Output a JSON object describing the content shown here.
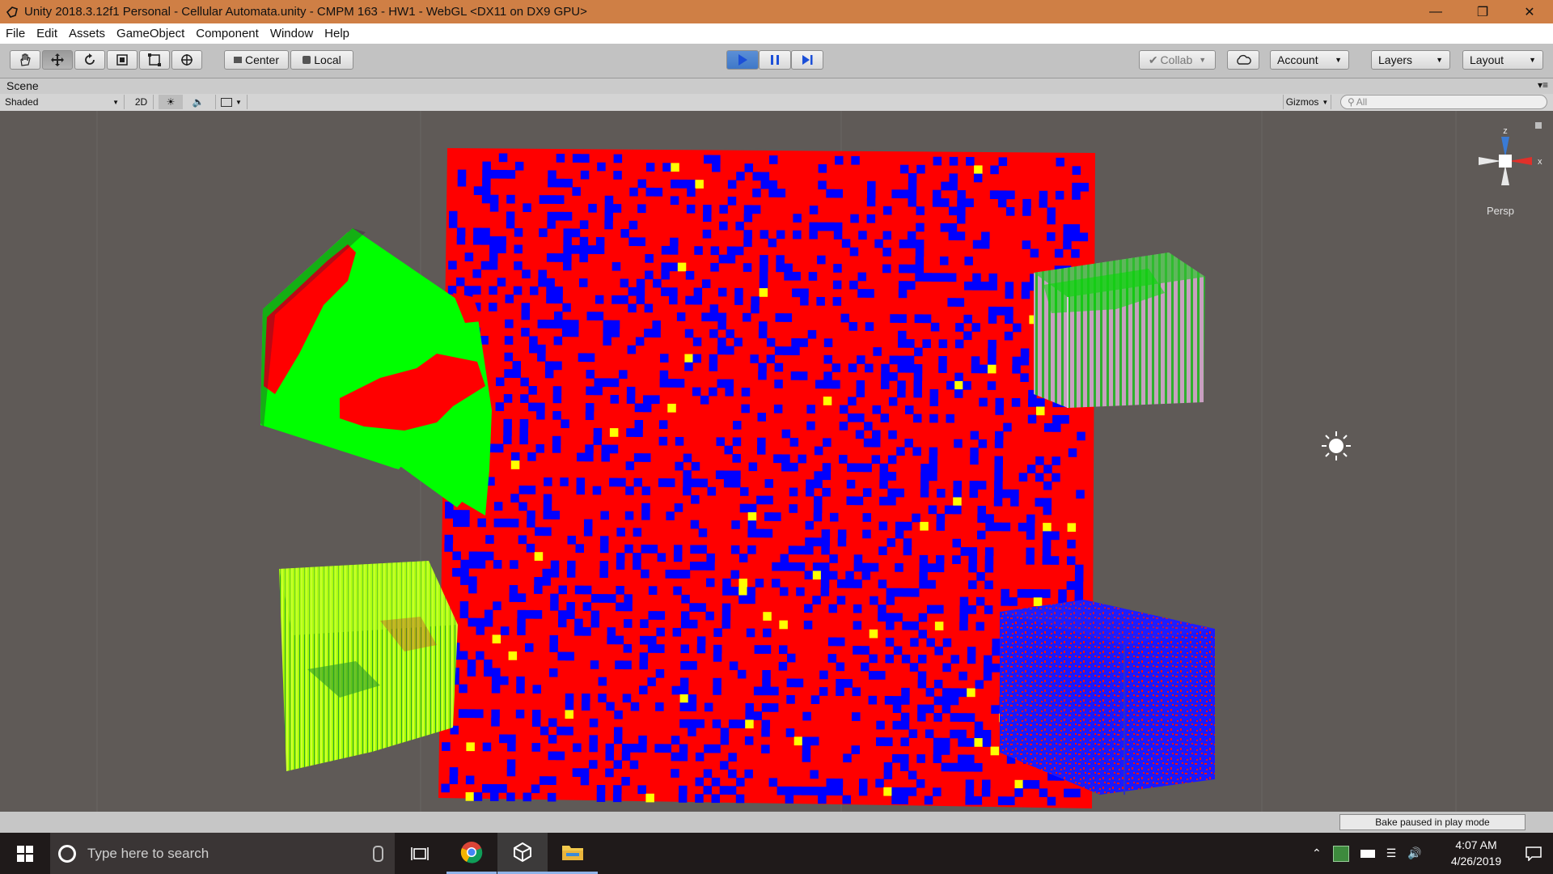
{
  "titlebar": {
    "title": "Unity 2018.3.12f1 Personal - Cellular Automata.unity - CMPM 163 - HW1 - WebGL <DX11 on DX9 GPU>",
    "icon": "unity-icon",
    "controls": [
      "minimize-icon",
      "restore-icon",
      "close-icon"
    ]
  },
  "menubar": {
    "items": [
      "File",
      "Edit",
      "Assets",
      "GameObject",
      "Component",
      "Window",
      "Help"
    ]
  },
  "toolbar": {
    "tools": [
      "hand-icon",
      "move-icon",
      "rotate-icon",
      "scale-icon",
      "rect-icon",
      "transform-icon"
    ],
    "pivot_label": "Center",
    "space_label": "Local",
    "play_controls": [
      "play-icon",
      "pause-icon",
      "step-icon"
    ],
    "collab_label": "Collab",
    "account_label": "Account",
    "layers_label": "Layers",
    "layout_label": "Layout"
  },
  "scene": {
    "tab_label": "Scene",
    "shading_mode": "Shaded",
    "toggle_2d": "2D",
    "gizmos_label": "Gizmos",
    "search_placeholder": "All",
    "persp_label": "Persp",
    "axis_x": "x",
    "axis_z": "z"
  },
  "statusbar": {
    "message": "Bake paused in play mode"
  },
  "taskbar": {
    "search_placeholder": "Type here to search",
    "time": "4:07 AM",
    "date": "4/26/2019"
  },
  "colors": {
    "titlebar": "#cf7f45",
    "red": "#ff0000",
    "blue": "#0000ff",
    "yellow": "#ffff00",
    "green": "#00ff00",
    "lime": "#99ff00",
    "magenta": "#c080c0"
  }
}
